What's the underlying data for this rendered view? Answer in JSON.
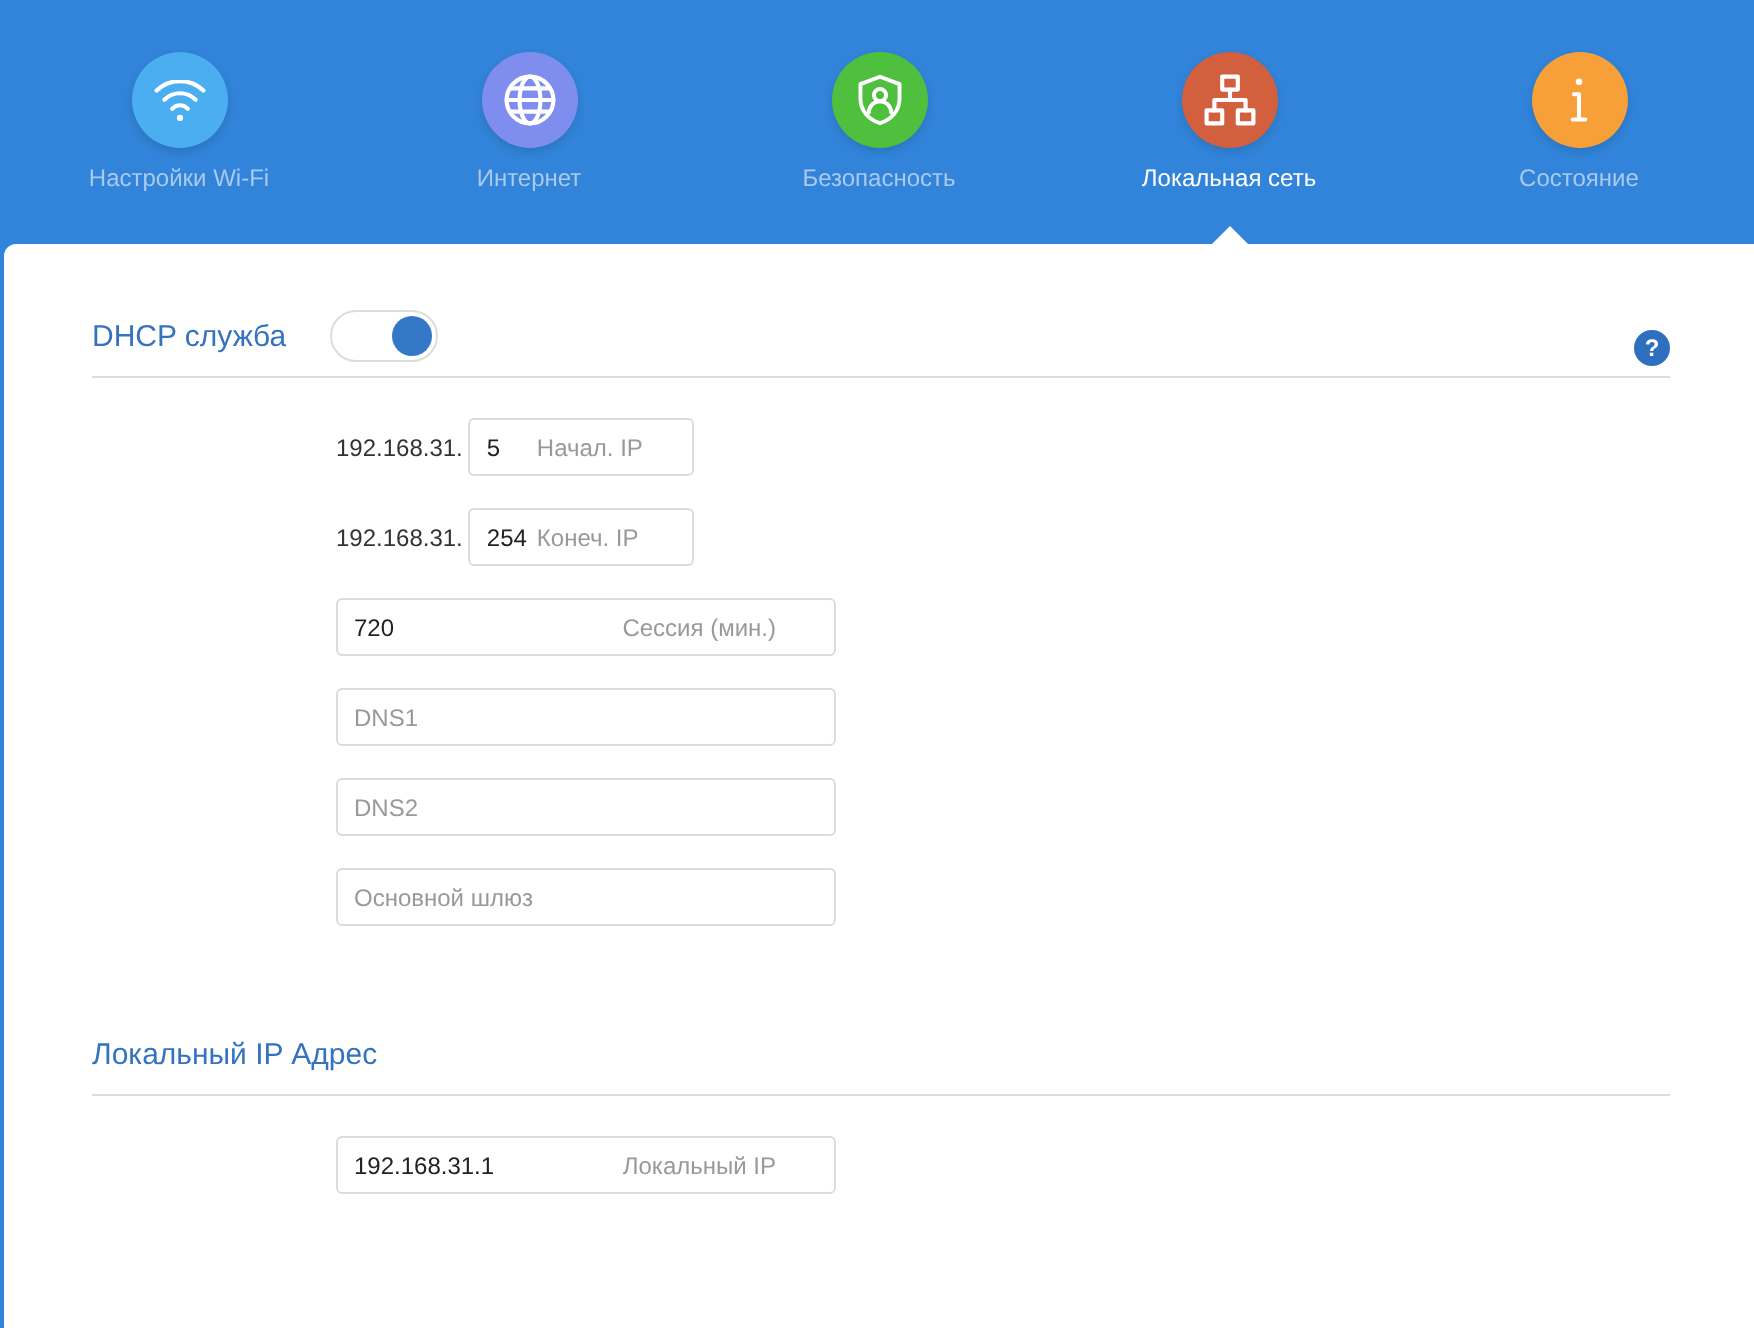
{
  "nav": [
    {
      "label": "Настройки Wi-Fi",
      "color": "#4aaef0",
      "selected": false
    },
    {
      "label": "Интернет",
      "color": "#7f8eee",
      "selected": false
    },
    {
      "label": "Безопасность",
      "color": "#4fbf3e",
      "selected": false
    },
    {
      "label": "Локальная сеть",
      "color": "#d2603f",
      "selected": true
    },
    {
      "label": "Состояние",
      "color": "#f7a03a",
      "selected": false
    }
  ],
  "sections": [
    {
      "title": "DHCP служба",
      "toggle": {
        "on": true
      },
      "help": "?",
      "fields": [
        {
          "kind": "short",
          "prefix": "192.168.31.",
          "value": "5",
          "label": "Начал. IP"
        },
        {
          "kind": "short",
          "prefix": "192.168.31.",
          "value": "254",
          "label": "Конеч. IP"
        },
        {
          "kind": "wide",
          "value": "720",
          "label": "Сессия (мин.)"
        },
        {
          "kind": "wide",
          "placeholder": "DNS1"
        },
        {
          "kind": "wide",
          "placeholder": "DNS2"
        },
        {
          "kind": "wide",
          "placeholder": "Основной шлюз"
        }
      ]
    },
    {
      "title": "Локальный IP Адрес",
      "fields": [
        {
          "kind": "wide",
          "value": "192.168.31.1",
          "label": "Локальный IP"
        }
      ]
    }
  ]
}
